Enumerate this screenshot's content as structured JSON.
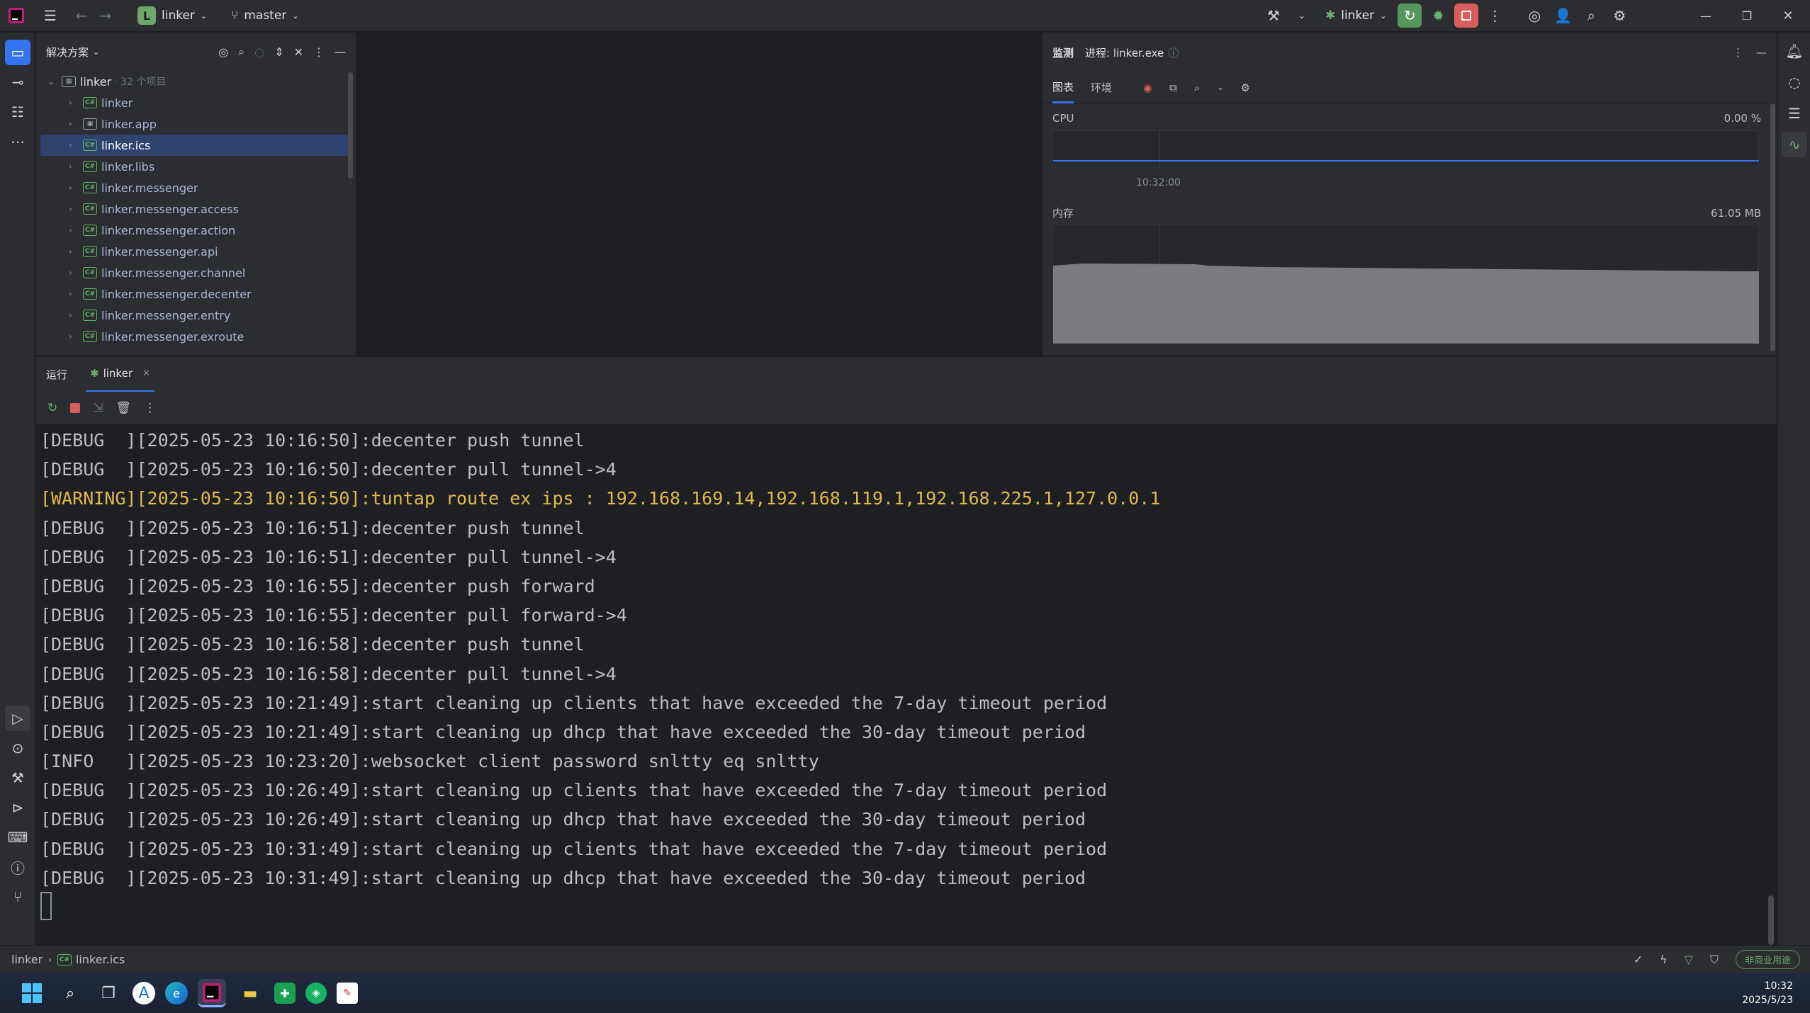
{
  "titlebar": {
    "project_badge": "L",
    "project_name": "linker",
    "branch": "master",
    "run_config": "linker"
  },
  "solution": {
    "header": "解决方案",
    "root_name": "linker",
    "root_count": "· 32 个项目",
    "items": [
      {
        "label": "linker",
        "kind": "C#"
      },
      {
        "label": "linker.app",
        "kind": "app"
      },
      {
        "label": "linker.ics",
        "kind": "C#"
      },
      {
        "label": "linker.libs",
        "kind": "C#"
      },
      {
        "label": "linker.messenger",
        "kind": "C#"
      },
      {
        "label": "linker.messenger.access",
        "kind": "C#"
      },
      {
        "label": "linker.messenger.action",
        "kind": "C#"
      },
      {
        "label": "linker.messenger.api",
        "kind": "C#"
      },
      {
        "label": "linker.messenger.channel",
        "kind": "C#"
      },
      {
        "label": "linker.messenger.decenter",
        "kind": "C#"
      },
      {
        "label": "linker.messenger.entry",
        "kind": "C#"
      },
      {
        "label": "linker.messenger.exroute",
        "kind": "C#"
      }
    ],
    "selected_index": 2
  },
  "monitor": {
    "title": "监测",
    "process_label": "进程: linker.exe",
    "tabs": [
      "图表",
      "环境"
    ],
    "cpu_label": "CPU",
    "cpu_value": "0.00 %",
    "time_label": "10:32:00",
    "mem_label": "内存",
    "mem_value": "61.05 MB"
  },
  "run": {
    "tab_run": "运行",
    "tab_config": "linker"
  },
  "console": {
    "lines": [
      {
        "text": "[DEBUG  ][2025-05-23 10:16:50]:decenter push tunnel",
        "level": "debug"
      },
      {
        "text": "[DEBUG  ][2025-05-23 10:16:50]:decenter pull tunnel->4",
        "level": "debug"
      },
      {
        "text": "[WARNING][2025-05-23 10:16:50]:tuntap route ex ips : 192.168.169.14,192.168.119.1,192.168.225.1,127.0.0.1",
        "level": "warn"
      },
      {
        "text": "[DEBUG  ][2025-05-23 10:16:51]:decenter push tunnel",
        "level": "debug"
      },
      {
        "text": "[DEBUG  ][2025-05-23 10:16:51]:decenter pull tunnel->4",
        "level": "debug"
      },
      {
        "text": "[DEBUG  ][2025-05-23 10:16:55]:decenter push forward",
        "level": "debug"
      },
      {
        "text": "[DEBUG  ][2025-05-23 10:16:55]:decenter pull forward->4",
        "level": "debug"
      },
      {
        "text": "[DEBUG  ][2025-05-23 10:16:58]:decenter push tunnel",
        "level": "debug"
      },
      {
        "text": "[DEBUG  ][2025-05-23 10:16:58]:decenter pull tunnel->4",
        "level": "debug"
      },
      {
        "text": "[DEBUG  ][2025-05-23 10:21:49]:start cleaning up clients that have exceeded the 7-day timeout period",
        "level": "debug"
      },
      {
        "text": "[DEBUG  ][2025-05-23 10:21:49]:start cleaning up dhcp that have exceeded the 30-day timeout period",
        "level": "debug"
      },
      {
        "text": "[INFO   ][2025-05-23 10:23:20]:websocket client password snltty eq snltty",
        "level": "info"
      },
      {
        "text": "[DEBUG  ][2025-05-23 10:26:49]:start cleaning up clients that have exceeded the 7-day timeout period",
        "level": "debug"
      },
      {
        "text": "[DEBUG  ][2025-05-23 10:26:49]:start cleaning up dhcp that have exceeded the 30-day timeout period",
        "level": "debug"
      },
      {
        "text": "[DEBUG  ][2025-05-23 10:31:49]:start cleaning up clients that have exceeded the 7-day timeout period",
        "level": "debug"
      },
      {
        "text": "[DEBUG  ][2025-05-23 10:31:49]:start cleaning up dhcp that have exceeded the 30-day timeout period",
        "level": "debug"
      }
    ]
  },
  "statusbar": {
    "crumb_root": "linker",
    "crumb_file": "linker.ics",
    "license_badge": "非商业用途"
  },
  "taskbar": {
    "time": "10:32",
    "date": "2025/5/23"
  },
  "colors": {
    "accent": "#3574f0",
    "run_green": "#57965c",
    "stop_red": "#db5c5c",
    "warning": "#e0b94a"
  }
}
